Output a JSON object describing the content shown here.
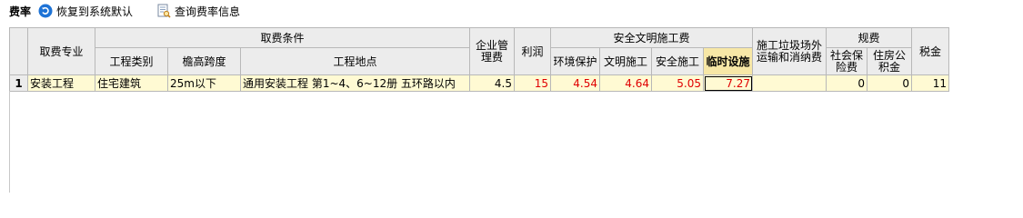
{
  "toolbar": {
    "title": "费率",
    "restore_label": "恢复到系统默认",
    "query_label": "查询费率信息"
  },
  "colors": {
    "restore_icon": "#1e73d6",
    "cell_bg": "#fffad3",
    "header_bg": "#ececec",
    "highlight_header": "#f7e7a6",
    "red_text": "#e00000"
  },
  "table": {
    "headers": {
      "fee_major": "取费专业",
      "fee_condition": "取费条件",
      "project_type": "工程类别",
      "eave_height": "檐高跨度",
      "project_location": "工程地点",
      "mgmt_fee_line1": "企业管",
      "mgmt_fee_line2": "理费",
      "profit": "利润",
      "safety_civil": "安全文明施工费",
      "env_protection": "环境保护",
      "civil_construction": "文明施工",
      "safe_construction": "安全施工",
      "temp_facilities": "临时设施",
      "waste_line1": "施工垃圾场外",
      "waste_line2": "运输和消纳费",
      "regulatory": "规费",
      "social_ins_line1": "社会保",
      "social_ins_line2": "险费",
      "housing_fund_line1": "住房公",
      "housing_fund_line2": "积金",
      "tax": "税金"
    },
    "rows": [
      {
        "no": "1",
        "fee_major": "安装工程",
        "project_type": "住宅建筑",
        "eave_height": "25m以下",
        "project_location": "通用安装工程 第1~4、6~12册 五环路以内",
        "mgmt_fee": "4.5",
        "profit": "15",
        "env_protection": "4.54",
        "civil_construction": "4.64",
        "safe_construction": "5.05",
        "temp_facilities": "7.27",
        "waste": "",
        "social_ins": "0",
        "housing_fund": "0",
        "tax": "11"
      }
    ]
  }
}
